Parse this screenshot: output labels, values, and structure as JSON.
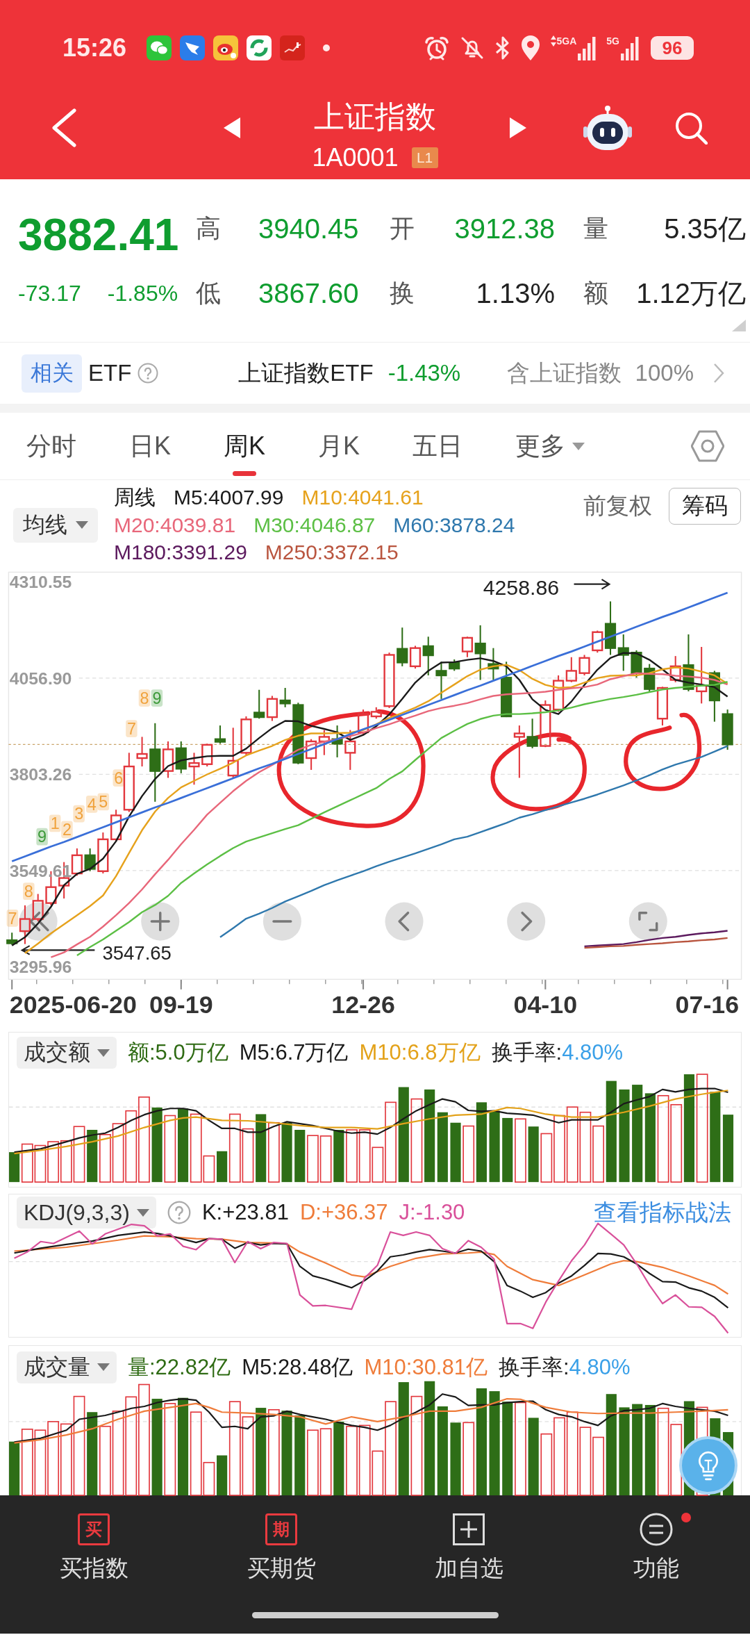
{
  "status_bar": {
    "time": "15:26",
    "signals": [
      {
        "label": "5GA",
        "data_active": true
      },
      {
        "label": "5G",
        "data_active": false
      }
    ],
    "battery": "96"
  },
  "header": {
    "title": "上证指数",
    "code": "1A0001",
    "level_badge": "L1"
  },
  "quote": {
    "price": "3882.41",
    "change": "-73.17",
    "change_percent": "-1.85%",
    "falling": true,
    "fields": [
      {
        "label": "高",
        "value": "3940.45",
        "color": "#0f9d2f"
      },
      {
        "label": "开",
        "value": "3912.38",
        "color": "#0f9d2f"
      },
      {
        "label": "量",
        "value": "5.35亿",
        "color": "#222222"
      },
      {
        "label": "低",
        "value": "3867.60",
        "color": "#0f9d2f"
      },
      {
        "label": "换",
        "value": "1.13%",
        "color": "#222222"
      },
      {
        "label": "额",
        "value": "1.12万亿",
        "color": "#222222"
      }
    ]
  },
  "related_etf": {
    "tag": "相关",
    "label": "ETF",
    "fund": "上证指数ETF",
    "change": "-1.43%",
    "falling": true,
    "holding_label": "含上证指数",
    "holding": "100%"
  },
  "period_tabs": [
    {
      "label": "分时",
      "kind": "tab",
      "selected": false
    },
    {
      "label": "日K",
      "kind": "tab",
      "selected": false
    },
    {
      "label": "周K",
      "kind": "tab",
      "selected": true
    },
    {
      "label": "月K",
      "kind": "tab",
      "selected": false
    },
    {
      "label": "五日",
      "kind": "tab",
      "selected": false
    },
    {
      "label": "更多",
      "kind": "dropdown",
      "selected": false
    }
  ],
  "ma_legend": {
    "selector": "均线",
    "period": "周线",
    "items": [
      {
        "label": "M5:4007.99",
        "color": "#1a1a1a"
      },
      {
        "label": "M10:4041.61",
        "color": "#e6a21c"
      },
      {
        "label": "M20:4039.81",
        "color": "#e8677a"
      },
      {
        "label": "M30:4046.87",
        "color": "#5cbf45"
      },
      {
        "label": "M60:3878.24",
        "color": "#2f78ad"
      },
      {
        "label": "M180:3391.29",
        "color": "#5c1a5e"
      },
      {
        "label": "M250:3372.15",
        "color": "#b9553f"
      }
    ],
    "adjustment": "前复权",
    "chips_button": "筹码"
  },
  "kline_chart": {
    "high_label": "4258.86",
    "low_label": "3547.65",
    "start_date": "2025-06-20",
    "end_date": "07-16",
    "sequence_marks": [
      {
        "text": "7",
        "color": "#f0a23c"
      },
      {
        "text": "8",
        "color": "#f0a23c"
      },
      {
        "text": "9",
        "color": "#3d9a3a"
      },
      {
        "text": "1",
        "color": "#f0a23c"
      },
      {
        "text": "2",
        "color": "#f0a23c"
      },
      {
        "text": "3",
        "color": "#f0a23c"
      },
      {
        "text": "4",
        "color": "#f0a23c"
      },
      {
        "text": "5",
        "color": "#f0a23c"
      },
      {
        "text": "6",
        "color": "#f0a23c"
      },
      {
        "text": "7",
        "color": "#f0a23c"
      },
      {
        "text": "8",
        "color": "#f0a23c"
      },
      {
        "text": "9",
        "color": "#3d9a3a"
      }
    ],
    "chart_data": {
      "type": "candlestick",
      "grid": true,
      "categories": [
        null,
        null,
        null,
        null,
        null,
        null,
        null,
        null,
        null,
        null,
        null,
        null,
        null,
        "09-19",
        null,
        null,
        null,
        null,
        null,
        null,
        null,
        null,
        null,
        null,
        null,
        null,
        null,
        "12-26",
        null,
        null,
        null,
        null,
        null,
        null,
        null,
        null,
        null,
        null,
        null,
        null,
        null,
        "04-10",
        null,
        null,
        null,
        null,
        null,
        null,
        null,
        null,
        null,
        null,
        null,
        null,
        null,
        null
      ],
      "ylim": [
        3263,
        4336
      ],
      "yticks": [
        4310.55,
        {
          "value": 4056.9,
          "label": "4056.90"
        },
        3803.26,
        3549.61,
        3295.96
      ],
      "ref_lines": [
        {
          "axis": "y",
          "value": 3882
        }
      ],
      "ohlc": [
        [
          3366,
          3386,
          3354,
          3358
        ],
        [
          3390,
          3458,
          3356,
          3422
        ],
        [
          3422,
          3488,
          3416,
          3470
        ],
        [
          3464,
          3548,
          3458,
          3506
        ],
        [
          3510,
          3572,
          3476,
          3530
        ],
        [
          3542,
          3608,
          3536,
          3590
        ],
        [
          3590,
          3608,
          3548,
          3554
        ],
        [
          3548,
          3650,
          3542,
          3632
        ],
        [
          3632,
          3710,
          3626,
          3695
        ],
        [
          3710,
          3860,
          3704,
          3824
        ],
        [
          3846,
          3902,
          3824,
          3857
        ],
        [
          3869,
          3938,
          3731,
          3812
        ],
        [
          3812,
          3890,
          3794,
          3869
        ],
        [
          3872,
          3890,
          3806,
          3818
        ],
        [
          3824,
          3860,
          3776,
          3833
        ],
        [
          3830,
          3884,
          3824,
          3881
        ],
        [
          3896,
          3932,
          3884,
          3889
        ],
        [
          3800,
          3926,
          3794,
          3839
        ],
        [
          3860,
          3956,
          3854,
          3948
        ],
        [
          3966,
          4026,
          3950,
          3954
        ],
        [
          3954,
          4010,
          3944,
          4002
        ],
        [
          3998,
          4031,
          3980,
          3990
        ],
        [
          3986,
          3992,
          3830,
          3834
        ],
        [
          3846,
          3896,
          3815,
          3890
        ],
        [
          3890,
          3920,
          3854,
          3902
        ],
        [
          3896,
          3932,
          3848,
          3884
        ],
        [
          3860,
          3920,
          3815,
          3890
        ],
        [
          3914,
          3974,
          3908,
          3962
        ],
        [
          3956,
          3980,
          3950,
          3968
        ],
        [
          3983,
          4124,
          3978,
          4118
        ],
        [
          4134,
          4190,
          4088,
          4098
        ],
        [
          4088,
          4142,
          4082,
          4136
        ],
        [
          4141,
          4166,
          4064,
          4117
        ],
        [
          4076,
          4100,
          4002,
          4064
        ],
        [
          4098,
          4106,
          4076,
          4082
        ],
        [
          4127,
          4166,
          4112,
          4163
        ],
        [
          4148,
          4196,
          4052,
          4122
        ],
        [
          4094,
          4136,
          4052,
          4082
        ],
        [
          4058,
          4100,
          3954,
          3956
        ],
        [
          3902,
          3932,
          3794,
          3911
        ],
        [
          3902,
          3950,
          3872,
          3878
        ],
        [
          3878,
          3998,
          3875,
          3986
        ],
        [
          3974,
          4064,
          3968,
          4050
        ],
        [
          4050,
          4112,
          4046,
          4076
        ],
        [
          4070,
          4118,
          4064,
          4110
        ],
        [
          4130,
          4182,
          4124,
          4178
        ],
        [
          4200,
          4259,
          4118,
          4136
        ],
        [
          4136,
          4172,
          4076,
          4118
        ],
        [
          4124,
          4130,
          4058,
          4070
        ],
        [
          4082,
          4094,
          4022,
          4028
        ],
        [
          3950,
          4034,
          3932,
          4031
        ],
        [
          4052,
          4115,
          4046,
          4088
        ],
        [
          4091,
          4172,
          4022,
          4028
        ],
        [
          4022,
          4139,
          3990,
          4037
        ],
        [
          4070,
          4076,
          3942,
          3998
        ],
        [
          3962,
          3974,
          3868,
          3882
        ]
      ],
      "series": [
        {
          "type": "line",
          "color": "#1a1a1a",
          "values": [
            3352,
            3374,
            3410,
            3454,
            3511,
            3541,
            3554,
            3581,
            3627,
            3692,
            3746,
            3791,
            3825,
            3840,
            3846,
            3851,
            3852,
            3852,
            3871,
            3899,
            3925,
            3944,
            3943,
            3931,
            3923,
            3914,
            3894,
            3907,
            3930,
            3961,
            4002,
            4045,
            4076,
            4098,
            4099,
            4105,
            4109,
            4102,
            4088,
            4052,
            4001,
            3973,
            3962,
            3995,
            4039,
            4079,
            4110,
            4123,
            4122,
            4105,
            4080,
            4052,
            4045,
            4040,
            4033,
            4008
          ]
        },
        {
          "type": "line",
          "color": "#e6a21c",
          "values": [
            null,
            3332,
            3357,
            3384,
            3408,
            3432,
            3456,
            3484,
            3535,
            3596,
            3656,
            3705,
            3741,
            3769,
            3786,
            3803,
            3818,
            3834,
            3853,
            3866,
            3878,
            3894,
            3905,
            3911,
            3911,
            3912,
            3913,
            3920,
            3935,
            3952,
            3965,
            3979,
            3996,
            4018,
            4040,
            4062,
            4079,
            4088,
            4092,
            4078,
            4055,
            4039,
            4031,
            4033,
            4045,
            4057,
            4063,
            4064,
            4064,
            4070,
            4080,
            4085,
            4082,
            4074,
            4064,
            4042
          ]
        },
        {
          "type": "line",
          "color": "#e8677a",
          "values": [
            null,
            null,
            null,
            3321,
            3334,
            3355,
            3375,
            3402,
            3432,
            3464,
            3500,
            3540,
            3578,
            3619,
            3657,
            3697,
            3728,
            3759,
            3786,
            3809,
            3828,
            3848,
            3868,
            3881,
            3889,
            3896,
            3904,
            3913,
            3925,
            3935,
            3947,
            3958,
            3970,
            3978,
            3984,
            3991,
            4001,
            4010,
            4014,
            4016,
            4018,
            4021,
            4026,
            4030,
            4033,
            4040,
            4054,
            4062,
            4070,
            4068,
            4067,
            4063,
            4061,
            4058,
            4052,
            4040
          ]
        },
        {
          "type": "line",
          "color": "#5cbf45",
          "values": [
            null,
            null,
            null,
            null,
            null,
            3326,
            3348,
            3368,
            3391,
            3414,
            3440,
            3459,
            3483,
            3517,
            3542,
            3566,
            3588,
            3609,
            3626,
            3637,
            3648,
            3659,
            3669,
            3686,
            3703,
            3719,
            3735,
            3751,
            3767,
            3791,
            3811,
            3841,
            3870,
            3899,
            3918,
            3936,
            3949,
            3958,
            3962,
            3962,
            3964,
            3967,
            3972,
            3979,
            3988,
            3995,
            4002,
            4007,
            4013,
            4020,
            4027,
            4031,
            4034,
            4037,
            4039,
            4047
          ]
        },
        {
          "type": "line",
          "color": "#2f78ad",
          "values": [
            null,
            null,
            null,
            null,
            null,
            null,
            null,
            null,
            null,
            null,
            null,
            null,
            null,
            null,
            null,
            null,
            3374,
            3398,
            3423,
            3436,
            3451,
            3468,
            3482,
            3496,
            3511,
            3524,
            3536,
            3548,
            3561,
            3573,
            3584,
            3595,
            3607,
            3619,
            3632,
            3639,
            3651,
            3663,
            3675,
            3689,
            3698,
            3709,
            3719,
            3729,
            3739,
            3750,
            3762,
            3774,
            3787,
            3801,
            3816,
            3829,
            3839,
            3849,
            3863,
            3878
          ]
        },
        {
          "type": "line",
          "color": "#5c1a5e",
          "values": [
            null,
            null,
            null,
            null,
            null,
            null,
            null,
            null,
            null,
            null,
            null,
            null,
            null,
            null,
            null,
            null,
            null,
            null,
            null,
            null,
            null,
            null,
            null,
            null,
            null,
            null,
            null,
            null,
            null,
            null,
            null,
            null,
            null,
            null,
            null,
            null,
            null,
            null,
            null,
            null,
            null,
            null,
            null,
            null,
            3350,
            3352,
            3354,
            3356,
            3361,
            3367,
            3372,
            3375,
            3380,
            3384,
            3387,
            3391
          ]
        },
        {
          "type": "line",
          "color": "#b9553f",
          "values": [
            null,
            null,
            null,
            null,
            null,
            null,
            null,
            null,
            null,
            null,
            null,
            null,
            null,
            null,
            null,
            null,
            null,
            null,
            null,
            null,
            null,
            null,
            null,
            null,
            null,
            null,
            null,
            null,
            null,
            null,
            null,
            null,
            null,
            null,
            null,
            null,
            null,
            null,
            null,
            null,
            null,
            null,
            null,
            null,
            3346,
            3348,
            3350,
            3351,
            3354,
            3356,
            3358,
            3361,
            3363,
            3366,
            3368,
            3372
          ]
        },
        {
          "type": "line",
          "color": "#3a6fd8",
          "values": [
            3574,
            3587,
            3600,
            3613,
            3625,
            3638,
            3651,
            3664,
            3677,
            3690,
            3703,
            3716,
            3728,
            3741,
            3754,
            3767,
            3780,
            3793,
            3806,
            3819,
            3831,
            3844,
            3857,
            3870,
            3883,
            3896,
            3909,
            3922,
            3934,
            3947,
            3960,
            3973,
            3986,
            3999,
            4012,
            4025,
            4037,
            4050,
            4063,
            4076,
            4089,
            4102,
            4115,
            4127,
            4140,
            4153,
            4166,
            4179,
            4192,
            4205,
            4218,
            4230,
            4243,
            4256,
            4269,
            4282
          ]
        }
      ]
    }
  },
  "amount_panel": {
    "selector": "成交额",
    "readings": [
      {
        "text": "额:5.0万亿",
        "color": "#2f6b14"
      },
      {
        "text": "M5:6.7万亿",
        "color": "#1a1a1a"
      },
      {
        "text": "M10:6.8万亿",
        "color": "#e3a21a"
      }
    ],
    "turnover": {
      "label": "换手率:",
      "value": "4.80%"
    }
  },
  "kdj_panel": {
    "selector": "KDJ(9,3,3)",
    "readings": [
      {
        "text": "K:+23.81",
        "color": "#1a1a1a"
      },
      {
        "text": "D:+36.37",
        "color": "#ef7c3a"
      },
      {
        "text": "J:-1.30",
        "color": "#d9509a"
      }
    ],
    "link": "查看指标战法"
  },
  "volume_panel": {
    "selector": "成交量",
    "readings": [
      {
        "text": "量:22.82亿",
        "color": "#2f6b14"
      },
      {
        "text": "M5:28.48亿",
        "color": "#1a1a1a"
      },
      {
        "text": "M10:30.81亿",
        "color": "#ef7c3a"
      }
    ],
    "turnover": {
      "label": "换手率:",
      "value": "4.80%"
    }
  },
  "bottom_nav": [
    {
      "label": "买指数",
      "kind": "boxed_char",
      "icon_char": "买",
      "dot": false
    },
    {
      "label": "买期货",
      "kind": "boxed_char",
      "icon_char": "期",
      "dot": false
    },
    {
      "label": "加自选",
      "kind": "plus",
      "dot": false
    },
    {
      "label": "功能",
      "kind": "menu",
      "dot": true
    }
  ]
}
